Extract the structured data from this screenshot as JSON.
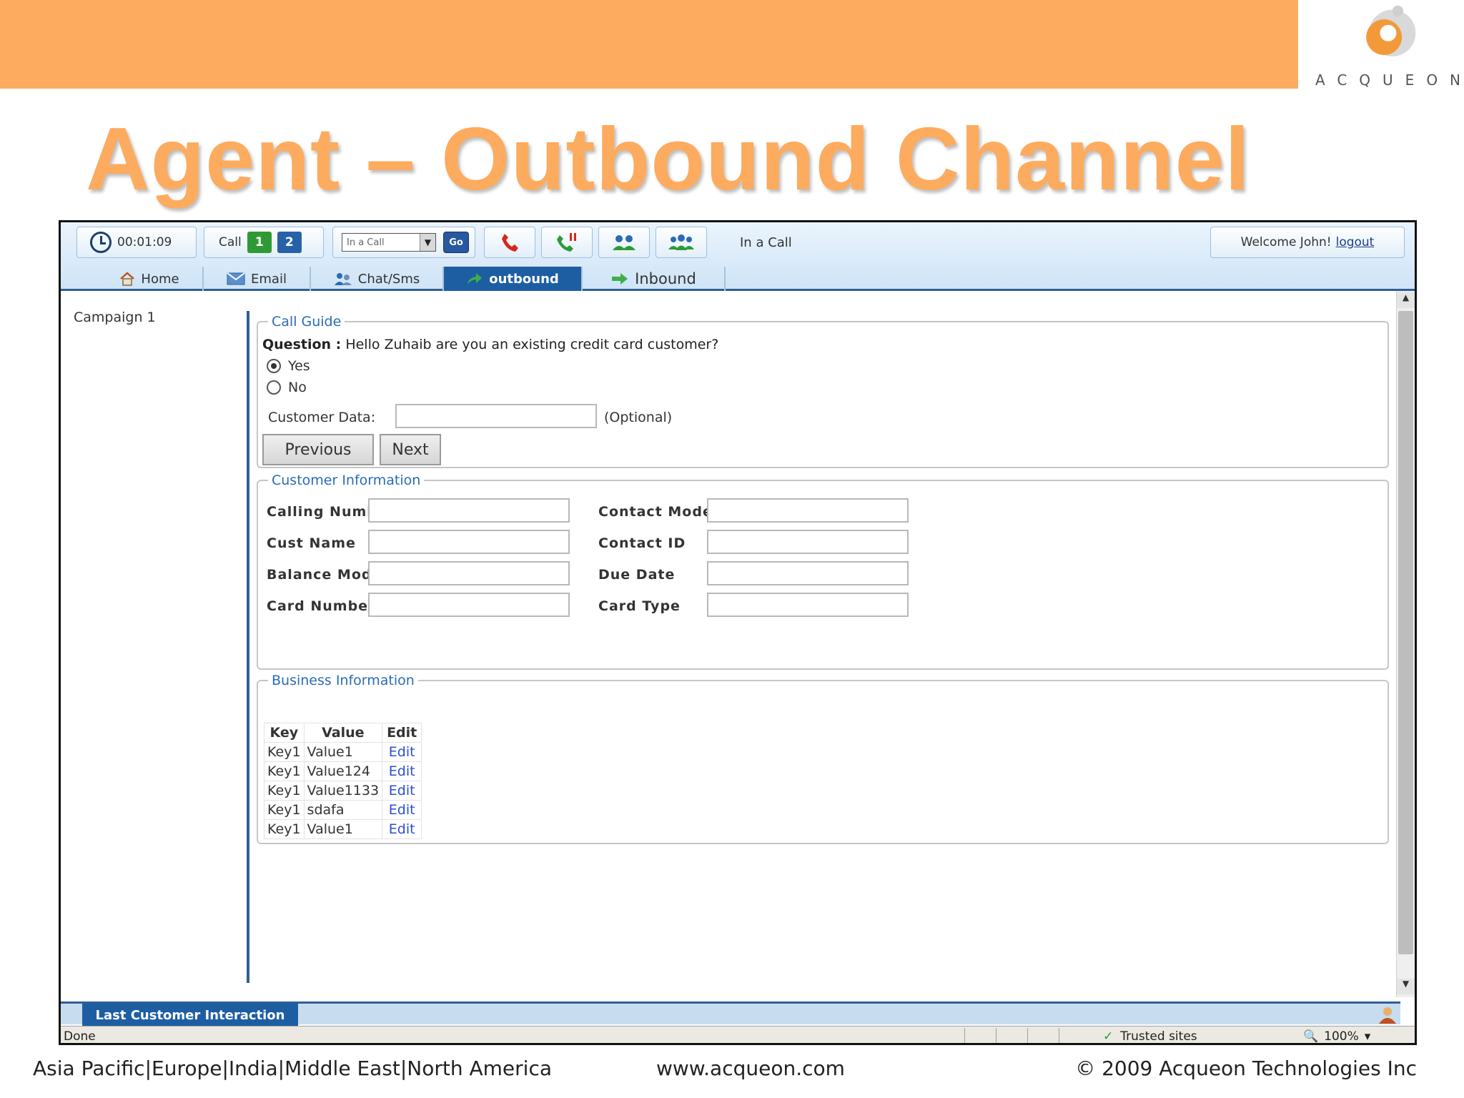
{
  "slide": {
    "title": "Agent – Outbound Channel",
    "logo_text": "ACQUEON",
    "footer_regions": "Asia Pacific|Europe|India|Middle East|North America",
    "footer_url": "www.acqueon.com",
    "footer_copyright": "© 2009 Acqueon Technologies Inc"
  },
  "colors": {
    "accent_orange": "#fdab5e",
    "nav_blue": "#1d5ea3",
    "legend_blue": "#2b6cb3",
    "link_blue": "#2b4fcf"
  },
  "toolbar": {
    "timer": "00:01:09",
    "call_label": "Call",
    "line1": "1",
    "line2": "2",
    "status_value": "In a Call",
    "go_label": "Go",
    "call_state": "In a Call",
    "welcome": "Welcome John!",
    "logout": "logout",
    "icons": [
      "clock-icon",
      "dial-phone-icon",
      "hold-phone-icon",
      "transfer-icon",
      "conference-icon"
    ]
  },
  "tabs": [
    {
      "label": "Home",
      "icon": "home-icon"
    },
    {
      "label": "Email",
      "icon": "envelope-icon"
    },
    {
      "label": "Chat/Sms",
      "icon": "chat-users-icon"
    },
    {
      "label": "outbound",
      "icon": "outbound-arrow-icon",
      "active": true
    },
    {
      "label": "Inbound",
      "icon": "inbound-arrow-icon"
    }
  ],
  "sidebar": {
    "campaign": "Campaign 1"
  },
  "call_guide": {
    "legend": "Call Guide",
    "question_label": "Question :",
    "question_text": "Hello Zuhaib are you an existing credit card customer?",
    "options": [
      {
        "label": "Yes",
        "selected": true
      },
      {
        "label": "No",
        "selected": false
      }
    ],
    "customer_data_label": "Customer Data:",
    "customer_data_value": "",
    "optional_label": "(Optional)",
    "previous_label": "Previous",
    "next_label": "Next"
  },
  "customer_info": {
    "legend": "Customer Information",
    "fields": [
      {
        "label": "Calling Number",
        "value": ""
      },
      {
        "label": "Contact Mode",
        "value": ""
      },
      {
        "label": "Cust Name",
        "value": ""
      },
      {
        "label": "Contact ID",
        "value": ""
      },
      {
        "label": "Balance Mode",
        "value": ""
      },
      {
        "label": "Due Date",
        "value": ""
      },
      {
        "label": "Card Number",
        "value": ""
      },
      {
        "label": "Card Type",
        "value": ""
      }
    ]
  },
  "business_info": {
    "legend": "Business Information",
    "columns": [
      "Key",
      "Value",
      "Edit"
    ],
    "rows": [
      [
        "Key1",
        "Value1",
        "Edit"
      ],
      [
        "Key1",
        "Value124",
        "Edit"
      ],
      [
        "Key1",
        "Value1133",
        "Edit"
      ],
      [
        "Key1",
        "sdafa",
        "Edit"
      ],
      [
        "Key1",
        "Value1",
        "Edit"
      ]
    ]
  },
  "bottom": {
    "last_interaction": "Last Customer Interaction",
    "status": "Done",
    "zone": "Trusted sites",
    "zoom": "100%"
  }
}
